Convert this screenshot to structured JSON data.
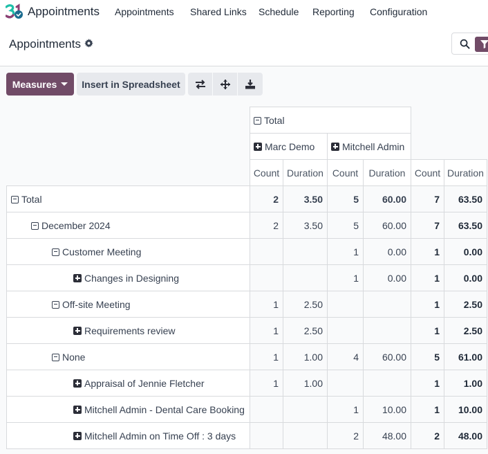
{
  "app": {
    "name": "Appointments",
    "brand_color": "#714b67"
  },
  "topnav": {
    "items": [
      {
        "label": "Appointments"
      },
      {
        "label": "Shared Links"
      },
      {
        "label": "Schedule"
      },
      {
        "label": "Reporting"
      },
      {
        "label": "Configuration"
      }
    ]
  },
  "control_panel": {
    "title": "Appointments",
    "settings_icon": "gear-icon",
    "search_icon": "search-icon",
    "filter_icon": "filter-icon"
  },
  "toolbar": {
    "measures_label": "Measures",
    "insert_label": "Insert in Spreadsheet",
    "flip_axis_icon": "exchange-icon",
    "expand_all_icon": "arrows-move-icon",
    "download_icon": "download-icon"
  },
  "pivot": {
    "col_total_label": "Total",
    "col_groups": [
      {
        "label": "Marc Demo"
      },
      {
        "label": "Mitchell Admin"
      }
    ],
    "measures": [
      "Count",
      "Duration",
      "Count",
      "Duration",
      "Count",
      "Duration"
    ],
    "rows": [
      {
        "label": "Total",
        "level": 0,
        "expanded": true,
        "values": [
          "2",
          "3.50",
          "5",
          "60.00",
          "7",
          "63.50"
        ]
      },
      {
        "label": "December 2024",
        "level": 1,
        "expanded": true,
        "values": [
          "2",
          "3.50",
          "5",
          "60.00",
          "7",
          "63.50"
        ]
      },
      {
        "label": "Customer Meeting",
        "level": 2,
        "expanded": true,
        "values": [
          "",
          "",
          "1",
          "0.00",
          "1",
          "0.00"
        ]
      },
      {
        "label": "Changes in Designing",
        "level": 3,
        "expanded": false,
        "values": [
          "",
          "",
          "1",
          "0.00",
          "1",
          "0.00"
        ]
      },
      {
        "label": "Off-site Meeting",
        "level": 2,
        "expanded": true,
        "values": [
          "1",
          "2.50",
          "",
          "",
          "1",
          "2.50"
        ]
      },
      {
        "label": "Requirements review",
        "level": 3,
        "expanded": false,
        "values": [
          "1",
          "2.50",
          "",
          "",
          "1",
          "2.50"
        ]
      },
      {
        "label": "None",
        "level": 2,
        "expanded": true,
        "values": [
          "1",
          "1.00",
          "4",
          "60.00",
          "5",
          "61.00"
        ]
      },
      {
        "label": "Appraisal of Jennie Fletcher",
        "level": 3,
        "expanded": false,
        "values": [
          "1",
          "1.00",
          "",
          "",
          "1",
          "1.00"
        ]
      },
      {
        "label": "Mitchell Admin - Dental Care Booking",
        "level": 3,
        "expanded": false,
        "values": [
          "",
          "",
          "1",
          "10.00",
          "1",
          "10.00"
        ]
      },
      {
        "label": "Mitchell Admin on Time Off : 3 days",
        "level": 3,
        "expanded": false,
        "values": [
          "",
          "",
          "2",
          "48.00",
          "2",
          "48.00"
        ]
      }
    ]
  }
}
